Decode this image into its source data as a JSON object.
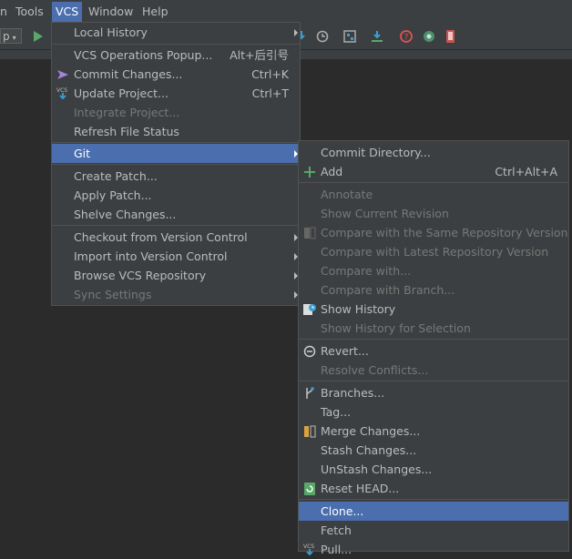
{
  "menubar": {
    "partial_left": "n",
    "tools": "Tools",
    "vcs": "VCS",
    "window": "Window",
    "help": "Help"
  },
  "toolbar": {
    "run_config": "p"
  },
  "vcs_menu": {
    "items": [
      {
        "label": "Local History",
        "shortcut": "",
        "enabled": true
      },
      {
        "label": "VCS Operations Popup...",
        "shortcut": "Alt+后引号",
        "enabled": true
      },
      {
        "label": "Commit Changes...",
        "shortcut": "Ctrl+K",
        "enabled": true
      },
      {
        "label": "Update Project...",
        "shortcut": "Ctrl+T",
        "enabled": true
      },
      {
        "label": "Integrate Project...",
        "shortcut": "",
        "enabled": false
      },
      {
        "label": "Refresh File Status",
        "shortcut": "",
        "enabled": true
      },
      {
        "label": "Git",
        "shortcut": "",
        "enabled": true
      },
      {
        "label": "Create Patch...",
        "shortcut": "",
        "enabled": true
      },
      {
        "label": "Apply Patch...",
        "shortcut": "",
        "enabled": true
      },
      {
        "label": "Shelve Changes...",
        "shortcut": "",
        "enabled": true
      },
      {
        "label": "Checkout from Version Control",
        "shortcut": "",
        "enabled": true
      },
      {
        "label": "Import into Version Control",
        "shortcut": "",
        "enabled": true
      },
      {
        "label": "Browse VCS Repository",
        "shortcut": "",
        "enabled": true
      },
      {
        "label": "Sync Settings",
        "shortcut": "",
        "enabled": false
      }
    ]
  },
  "git_menu": {
    "items": [
      {
        "label": "Commit Directory...",
        "shortcut": "",
        "enabled": true
      },
      {
        "label": "Add",
        "shortcut": "Ctrl+Alt+A",
        "enabled": true
      },
      {
        "label": "Annotate",
        "shortcut": "",
        "enabled": false
      },
      {
        "label": "Show Current Revision",
        "shortcut": "",
        "enabled": false
      },
      {
        "label": "Compare with the Same Repository Version",
        "shortcut": "",
        "enabled": false
      },
      {
        "label": "Compare with Latest Repository Version",
        "shortcut": "",
        "enabled": false
      },
      {
        "label": "Compare with...",
        "shortcut": "",
        "enabled": false
      },
      {
        "label": "Compare with Branch...",
        "shortcut": "",
        "enabled": false
      },
      {
        "label": "Show History",
        "shortcut": "",
        "enabled": true
      },
      {
        "label": "Show History for Selection",
        "shortcut": "",
        "enabled": false
      },
      {
        "label": "Revert...",
        "shortcut": "",
        "enabled": true
      },
      {
        "label": "Resolve Conflicts...",
        "shortcut": "",
        "enabled": false
      },
      {
        "label": "Branches...",
        "shortcut": "",
        "enabled": true
      },
      {
        "label": "Tag...",
        "shortcut": "",
        "enabled": true
      },
      {
        "label": "Merge Changes...",
        "shortcut": "",
        "enabled": true
      },
      {
        "label": "Stash Changes...",
        "shortcut": "",
        "enabled": true
      },
      {
        "label": "UnStash Changes...",
        "shortcut": "",
        "enabled": true
      },
      {
        "label": "Reset HEAD...",
        "shortcut": "",
        "enabled": true
      },
      {
        "label": "Clone...",
        "shortcut": "",
        "enabled": true
      },
      {
        "label": "Fetch",
        "shortcut": "",
        "enabled": true
      },
      {
        "label": "Pull...",
        "shortcut": "",
        "enabled": true
      }
    ]
  },
  "colors": {
    "menu_bg": "#3c3f41",
    "selection": "#4b6eaf",
    "editor_bg": "#2b2b2b",
    "text": "#bbbbbb",
    "disabled_text": "#777777"
  },
  "icons": {
    "run": "play-icon",
    "commit": "commit-arrow-icon",
    "update": "vcs-update-icon",
    "add": "plus-icon",
    "history": "history-clock-icon",
    "revert": "revert-icon",
    "branches": "branch-icon",
    "merge": "merge-icon",
    "reset": "reset-icon",
    "pull": "vcs-pull-icon"
  }
}
